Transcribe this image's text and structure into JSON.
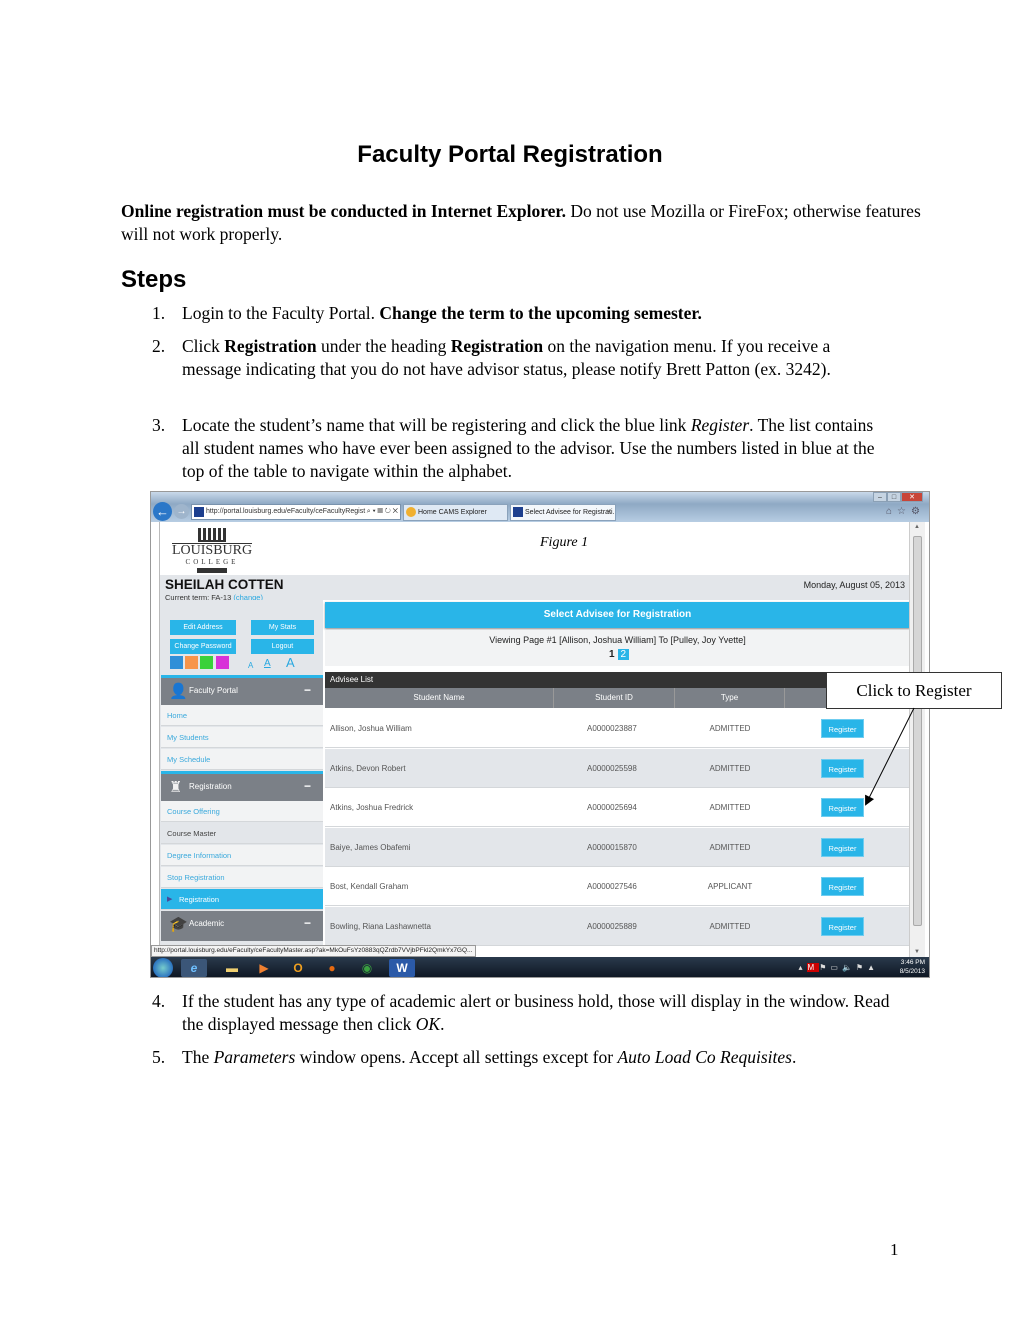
{
  "document": {
    "title": "Faculty Portal Registration",
    "intro_bold": "Online registration must be conducted in Internet Explorer.",
    "intro_rest": " Do not use Mozilla or FireFox; otherwise features will not work properly.",
    "steps_heading": "Steps",
    "steps": [
      {
        "num": "1.",
        "parts": [
          {
            "t": "Login to the Faculty Portal. "
          },
          {
            "t": "Change the term to the upcoming semester.",
            "b": true
          }
        ]
      },
      {
        "num": "2.",
        "parts": [
          {
            "t": "Click "
          },
          {
            "t": "Registration",
            "b": true
          },
          {
            "t": " under the heading "
          },
          {
            "t": "Registration",
            "b": true
          },
          {
            "t": " on the navigation menu. If you receive a message indicating that you do not have advisor status, please notify Brett Patton (ex. 3242)."
          }
        ]
      },
      {
        "num": "3.",
        "parts": [
          {
            "t": "Locate the student’s name that will be registering and click the blue link "
          },
          {
            "t": "Register",
            "i": true
          },
          {
            "t": ". The list contains all student names who have ever been assigned to the advisor. Use the numbers listed in blue at the top of the table to navigate within the alphabet."
          }
        ]
      },
      {
        "num": "4.",
        "parts": [
          {
            "t": "If the student has any type of academic alert or business hold, those will display in the window. Read the displayed message then click "
          },
          {
            "t": "OK",
            "i": true
          },
          {
            "t": "."
          }
        ]
      },
      {
        "num": "5.",
        "parts": [
          {
            "t": "The "
          },
          {
            "t": "Parameters",
            "i": true
          },
          {
            "t": " window opens. Accept all settings except for "
          },
          {
            "t": "Auto Load Co Requisites",
            "i": true
          },
          {
            "t": "."
          }
        ]
      }
    ],
    "page_number": "1",
    "callout": "Click to Register"
  },
  "browser": {
    "address": "http://portal.louisburg.edu/eFaculty/ceFacultyRegist",
    "address_icons": "⌕ ▾ ▤ ↻ ✕",
    "tabs": [
      {
        "label": "Home CAMS Explorer"
      },
      {
        "label": "Select Advisee for Registrati..."
      }
    ],
    "window_buttons": [
      "–",
      "□",
      "✕"
    ],
    "tools": "⌂☆⚙",
    "status_url": "http://portal.louisburg.edu/eFaculty/ceFacultyMaster.asp?ak=MkOuFsYz0883qQZrdb7VVjbPFkl2QmkYx7GQ..."
  },
  "portal": {
    "logo_name": "LOUISBURG",
    "logo_sub": "COLLEGE",
    "figure_caption": "Figure 1",
    "user_name": "SHEILAH COTTEN",
    "current_term_label": "Current term: FA-13 ",
    "change_link": "(change)",
    "date": "Monday, August 05, 2013",
    "buttons": {
      "edit_address": "Edit Address",
      "my_stats": "My Stats",
      "change_password": "Change Password",
      "logout": "Logout"
    },
    "theme_colors": [
      "#2f8fd8",
      "#f7944a",
      "#3ad13a",
      "#d832d8"
    ],
    "font_sizes": [
      "A",
      "A",
      "A"
    ],
    "nav": {
      "faculty_portal": {
        "label": "Faculty Portal",
        "items": [
          "Home",
          "My Students",
          "My Schedule"
        ]
      },
      "registration": {
        "label": "Registration",
        "items": [
          "Course Offering",
          "Course Master",
          "Degree Information",
          "Stop Registration",
          "Registration"
        ]
      },
      "academic": {
        "label": "Academic"
      }
    },
    "select_title": "Select Advisee for Registration",
    "viewing_text": "Viewing Page #1 [Allison, Joshua William] To [Pulley, Joy Yvette]",
    "pages": [
      "1",
      "2"
    ],
    "list_title": "Advisee List",
    "columns": [
      "Student Name",
      "Student ID",
      "Type",
      ""
    ],
    "register_label": "Register",
    "rows": [
      {
        "name": "Allison, Joshua William",
        "id": "A0000023887",
        "type": "ADMITTED"
      },
      {
        "name": "Atkins, Devon Robert",
        "id": "A0000025598",
        "type": "ADMITTED"
      },
      {
        "name": "Atkins, Joshua Fredrick",
        "id": "A0000025694",
        "type": "ADMITTED"
      },
      {
        "name": "Baiye, James Obafemi",
        "id": "A0000015870",
        "type": "ADMITTED"
      },
      {
        "name": "Bost, Kendall Graham",
        "id": "A0000027546",
        "type": "APPLICANT"
      },
      {
        "name": "Bowling, Riana Lashawnetta",
        "id": "A0000025889",
        "type": "ADMITTED"
      }
    ]
  },
  "taskbar": {
    "apps": [
      "start",
      "internet-explorer",
      "file-explorer",
      "media-player",
      "outlook",
      "firefox",
      "chrome",
      "word"
    ],
    "time": "3:46 PM",
    "date": "8/5/2013"
  }
}
